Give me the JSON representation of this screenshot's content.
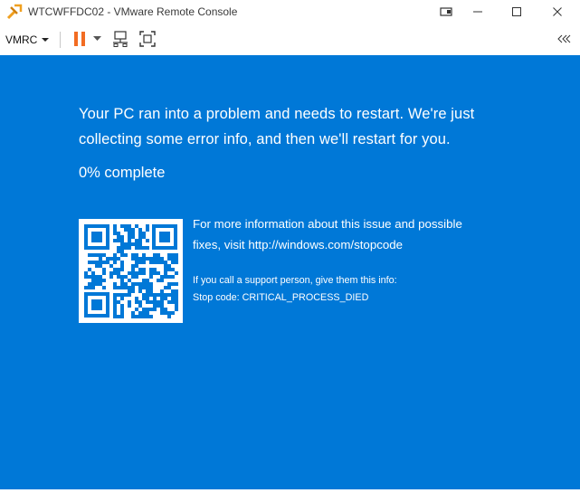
{
  "window": {
    "title": "WTCWFFDC02 - VMware Remote Console",
    "icons": [
      "vmrc-app-icon",
      "restore-icon",
      "minimize-icon",
      "maximize-icon",
      "close-icon"
    ]
  },
  "toolbar": {
    "vmrc_menu_label": "VMRC",
    "icons": [
      "pause-icon",
      "dropdown-caret-icon",
      "send-ctrl-alt-del-icon",
      "fullscreen-icon",
      "collapse-icon"
    ],
    "pause_color": "#f26c22"
  },
  "bsod": {
    "background_color": "#0078d7",
    "message": "Your PC ran into a problem and needs to restart. We're just collecting some error info, and then we'll restart for you.",
    "progress_text": "0% complete",
    "progress_percent": 0,
    "info_text": "For more information about this issue and possible fixes, visit http://windows.com/stopcode",
    "support_text": "If you call a support person, give them this info:",
    "stop_code_text": "Stop code: CRITICAL_PROCESS_DIED"
  }
}
